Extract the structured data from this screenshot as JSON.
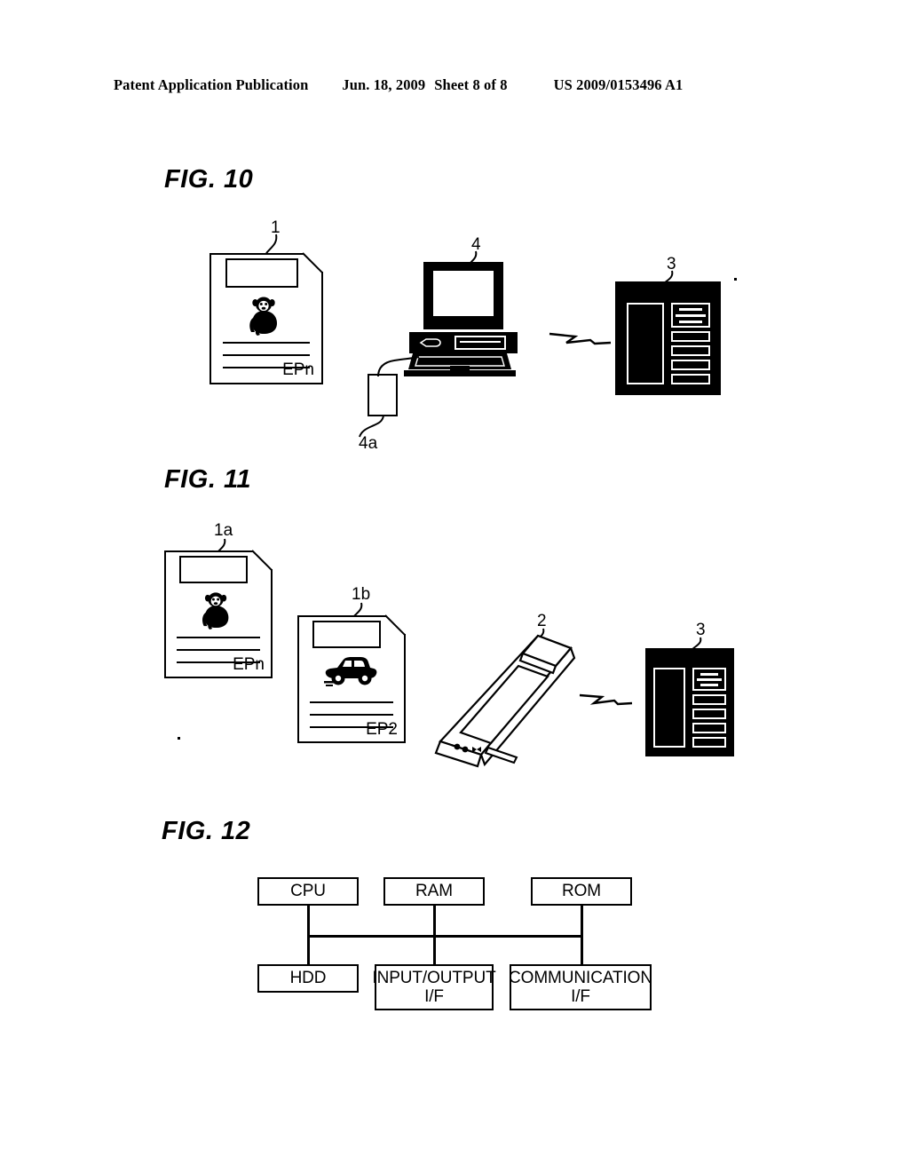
{
  "header": {
    "publication": "Patent Application Publication",
    "date": "Jun. 18, 2009",
    "sheet": "Sheet 8 of 8",
    "patent_number": "US 2009/0153496 A1"
  },
  "figures": [
    {
      "id": "fig10",
      "title": "FIG. 10",
      "elements": {
        "document": {
          "ref": "1",
          "label": "EPn",
          "image": "monkey-icon"
        },
        "computer": {
          "ref": "4"
        },
        "peripheral": {
          "ref": "4a"
        },
        "server": {
          "ref": "3"
        },
        "network_symbol": "network-zigzag-icon"
      }
    },
    {
      "id": "fig11",
      "title": "FIG. 11",
      "elements": {
        "document_a": {
          "ref": "1a",
          "label": "EPn",
          "image": "monkey-icon"
        },
        "document_b": {
          "ref": "1b",
          "label": "EP2",
          "image": "car-icon"
        },
        "tablet": {
          "ref": "2"
        },
        "server": {
          "ref": "3"
        },
        "network_symbol": "network-zigzag-icon"
      }
    },
    {
      "id": "fig12",
      "title": "FIG. 12",
      "blocks": {
        "top": [
          "CPU",
          "RAM",
          "ROM"
        ],
        "bottom": [
          "HDD",
          "INPUT/OUTPUT I/F",
          "COMMUNICATION I/F"
        ],
        "bottom_lines": [
          [
            "HDD"
          ],
          [
            "INPUT/OUTPUT",
            "I/F"
          ],
          [
            "COMMUNICATION",
            "I/F"
          ]
        ]
      }
    }
  ],
  "colors": {
    "ink": "#000000",
    "paper": "#ffffff"
  }
}
